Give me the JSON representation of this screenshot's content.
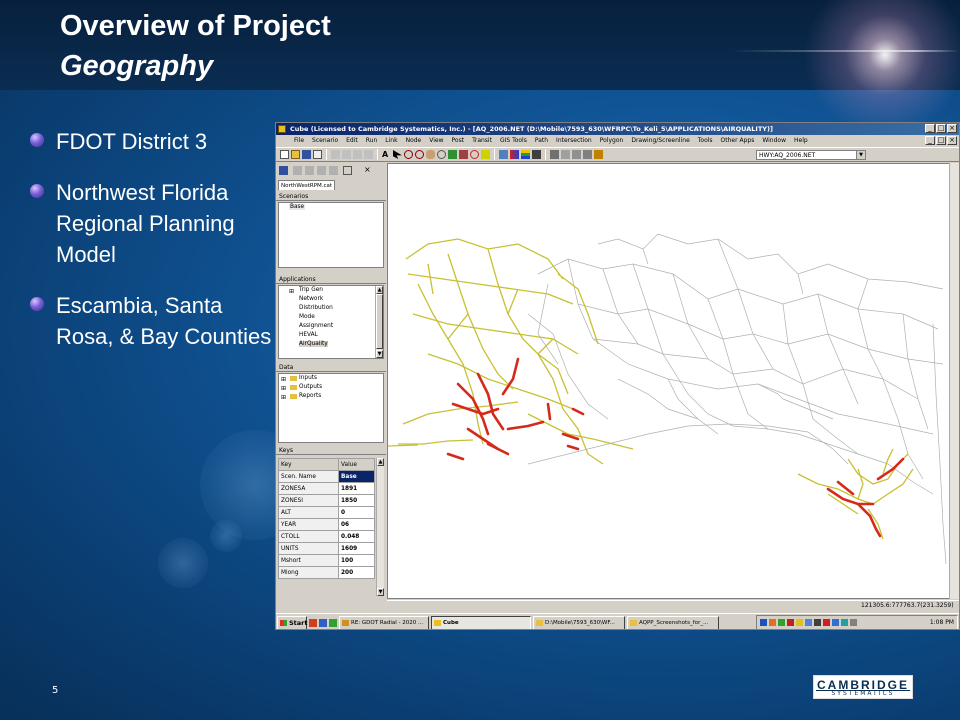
{
  "slide": {
    "title_line1": "Overview of Project",
    "title_line2": "Geography",
    "page_number": "5",
    "logo_main": "CAMBRIDGE",
    "logo_sub": "SYSTEMATICS",
    "bullets": [
      "FDOT District 3",
      "Northwest Florida Regional Planning Model",
      "Escambia, Santa Rosa, & Bay Counties"
    ]
  },
  "cube": {
    "window_title": "Cube (Licensed to Cambridge Systematics, Inc.) - [AQ_2006.NET (D:\\Mobile\\7593_630\\WFRPC\\To_Keli_5\\APPLICATIONS\\AIRQUALITY)]",
    "menu": [
      "File",
      "Scenario",
      "Edit",
      "Run",
      "Link",
      "Node",
      "View",
      "Post",
      "Transit",
      "GIS Tools",
      "Path",
      "Intersection",
      "Polygon",
      "Drawing/Screenline",
      "Tools",
      "Other Apps",
      "Window",
      "Help"
    ],
    "network_combo": "HWY:AQ_2006.NET",
    "catalog_tab": "NorthWestRPM.cat",
    "scenarios_header": "Scenarios",
    "scenarios": [
      "Base"
    ],
    "applications_header": "Applications",
    "applications": [
      "Trip Gen",
      "Network",
      "Distribution",
      "Mode",
      "Assignment",
      "HEVAL",
      "AirQuality"
    ],
    "data_header": "Data",
    "data_items": [
      "Inputs",
      "Outputs",
      "Reports"
    ],
    "keys_header": "Keys",
    "keys_columns": [
      "Key",
      "Value"
    ],
    "keys_rows": [
      [
        "Scen. Name",
        "Base"
      ],
      [
        "ZONESA",
        "1891"
      ],
      [
        "ZONESI",
        "1850"
      ],
      [
        "ALT",
        "0"
      ],
      [
        "YEAR",
        "06"
      ],
      [
        "CTOLL",
        "0.048"
      ],
      [
        "UNITS",
        "1609"
      ],
      [
        "Mshort",
        "100"
      ],
      [
        "Mlong",
        "200"
      ]
    ],
    "status_coords": "121305.6:777763.7(231.3259)",
    "colors": {
      "minor_roads": "#b0b0b0",
      "study_roads": "#c8c034",
      "congested": "#d42a1a"
    }
  },
  "taskbar": {
    "start_label": "Start",
    "tasks": [
      "RE: GDOT Radial - 2020 ...",
      "Cube",
      "D:\\Mobile\\7593_630\\WF...",
      "AQPP_Screenshots_for_..."
    ],
    "clock": "1:08 PM"
  }
}
